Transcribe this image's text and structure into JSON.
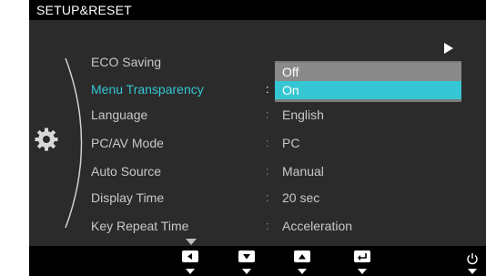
{
  "menu": {
    "title": "SETUP&RESET",
    "items": [
      {
        "label": "ECO Saving",
        "value": ""
      },
      {
        "label": "Menu Transparency",
        "value": ""
      },
      {
        "label": "Language",
        "value": "English"
      },
      {
        "label": "PC/AV Mode",
        "value": "PC"
      },
      {
        "label": "Auto Source",
        "value": "Manual"
      },
      {
        "label": "Display Time",
        "value": "20 sec"
      },
      {
        "label": "Key Repeat Time",
        "value": "Acceleration"
      }
    ],
    "colon": ":",
    "active_item": "Menu Transparency",
    "dropdown": {
      "options": [
        "Off",
        "On"
      ],
      "selected": "On"
    }
  },
  "icons": {
    "left": "gear-icon",
    "scroll": "triangle-right-icon",
    "buttons": [
      "left-arrow-icon",
      "down-arrow-icon",
      "up-arrow-icon",
      "enter-icon",
      "power-icon"
    ]
  },
  "colors": {
    "accent": "#35c6d3",
    "background": "#2b2b2b",
    "bar": "#000000"
  }
}
